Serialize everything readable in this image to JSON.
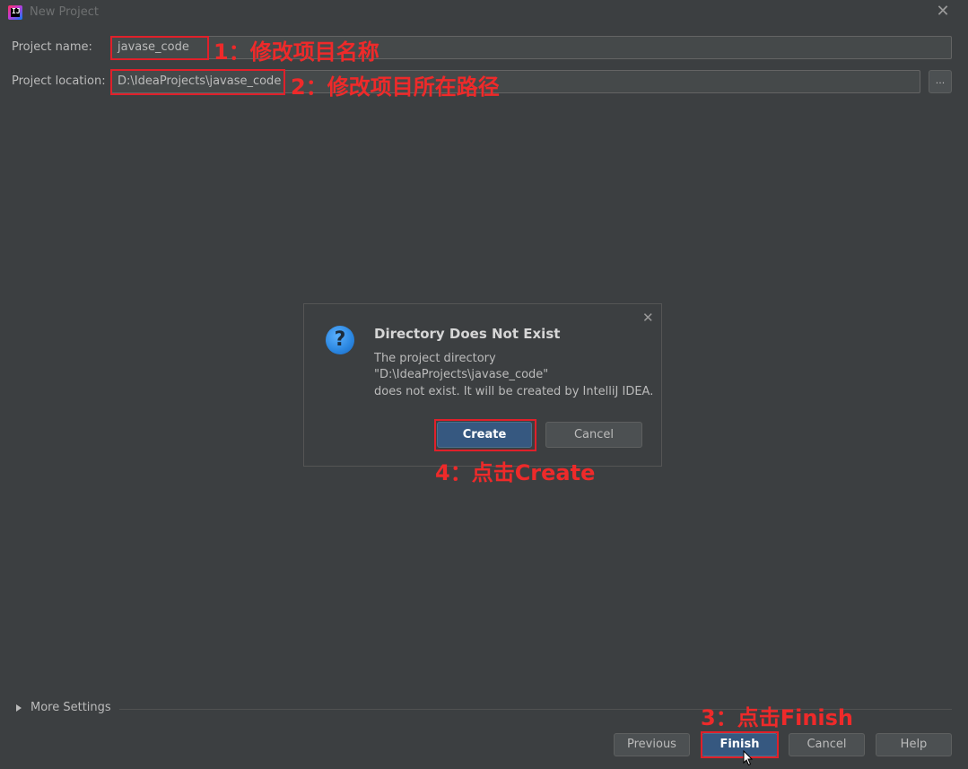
{
  "window": {
    "title": "New Project",
    "app_icon": "intellij-idea-icon",
    "app_icon_text": "IJ"
  },
  "form": {
    "project_name_label": "Project name:",
    "project_name_value": "javase_code",
    "project_location_label": "Project location:",
    "project_location_value": "D:\\IdeaProjects\\javase_code",
    "browse_label": "..."
  },
  "dialog": {
    "title": "Directory Does Not Exist",
    "message_lines": [
      "The project directory",
      "\"D:\\IdeaProjects\\javase_code\"",
      "does not exist. It will be created by IntelliJ IDEA."
    ],
    "create_label": "Create",
    "cancel_label": "Cancel",
    "icon": "question-icon"
  },
  "footer": {
    "more_settings_label": "More Settings",
    "previous_label": "Previous",
    "finish_label": "Finish",
    "cancel_label": "Cancel",
    "help_label": "Help"
  },
  "annotations": {
    "step1": "1：修改项目名称",
    "step2": "2：修改项目所在路径",
    "step3": "3：点击Finish",
    "step4": "4：点击Create",
    "color": "#ee2a2a"
  },
  "colors": {
    "background": "#3c3f41",
    "field_background": "#45494a",
    "default_button": "#365880"
  }
}
